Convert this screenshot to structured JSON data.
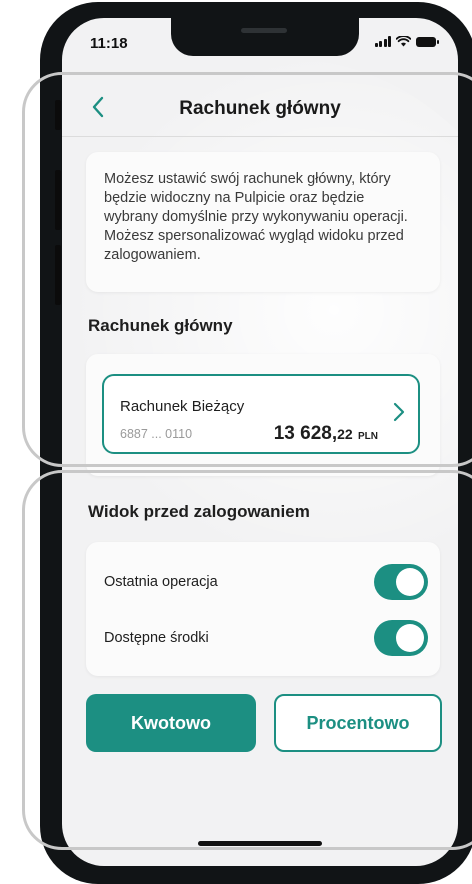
{
  "status_bar": {
    "time": "11:18"
  },
  "header": {
    "title": "Rachunek główny",
    "back_icon": "chevron-left-icon"
  },
  "info": {
    "lines": [
      "Możesz ustawić swój rachunek główny, który",
      "będzie widoczny na Pulpicie oraz będzie",
      "wybrany domyślnie przy wykonywaniu operacji.",
      "Możesz spersonalizować wygląd widoku przed",
      "zalogowaniem."
    ]
  },
  "main_account": {
    "section_title": "Rachunek główny",
    "account_name": "Rachunek Bieżący",
    "account_number": "6887 ... 0110",
    "balance_integer": "13 628,",
    "balance_decimal": "22",
    "currency": "PLN",
    "chevron_icon": "chevron-right-icon"
  },
  "pre_login_view": {
    "section_title": "Widok przed zalogowaniem",
    "toggles": [
      {
        "label": "Ostatnia operacja",
        "on": true
      },
      {
        "label": "Dostępne środki",
        "on": true
      }
    ]
  },
  "buttons": {
    "primary": "Kwotowo",
    "secondary": "Procentowo"
  },
  "colors": {
    "accent": "#1c8f82",
    "background": "#f2f2f3",
    "card": "#fbfbfb"
  }
}
